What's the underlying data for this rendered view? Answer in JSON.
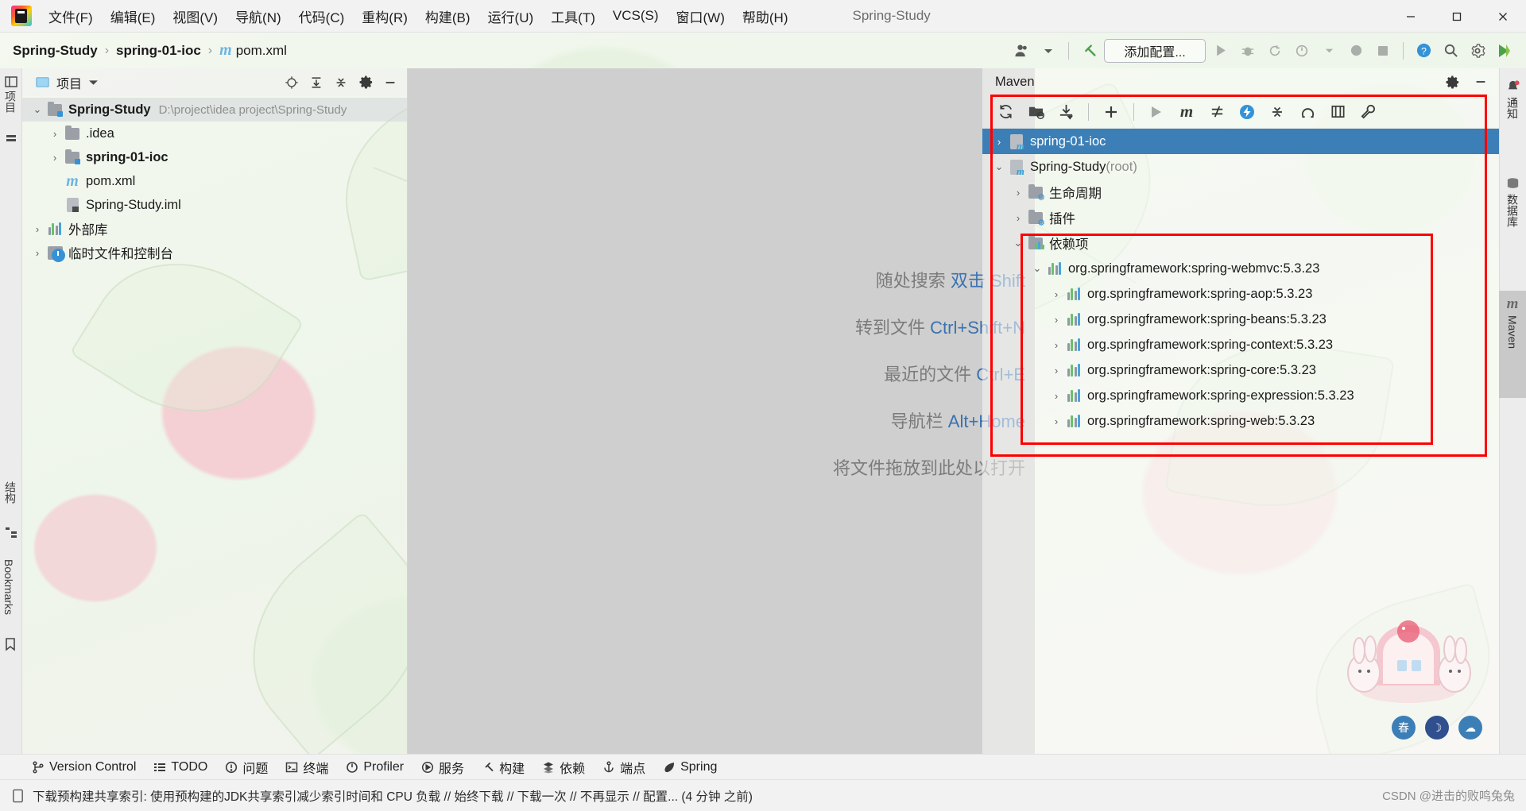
{
  "window": {
    "title": "Spring-Study",
    "minimize": "─",
    "maximize": "❐",
    "close": "✕"
  },
  "menubar": {
    "items": [
      {
        "label": "文件(F)"
      },
      {
        "label": "编辑(E)"
      },
      {
        "label": "视图(V)"
      },
      {
        "label": "导航(N)"
      },
      {
        "label": "代码(C)"
      },
      {
        "label": "重构(R)"
      },
      {
        "label": "构建(B)"
      },
      {
        "label": "运行(U)"
      },
      {
        "label": "工具(T)"
      },
      {
        "label": "VCS(S)"
      },
      {
        "label": "窗口(W)"
      },
      {
        "label": "帮助(H)"
      }
    ]
  },
  "navbar": {
    "breadcrumbs": [
      {
        "label": "Spring-Study",
        "bold": true
      },
      {
        "label": "spring-01-ioc",
        "bold": true
      },
      {
        "label": "pom.xml",
        "bold": false,
        "icon": "maven-file-icon"
      }
    ],
    "separator": "›",
    "run_config_label": "添加配置...",
    "icons": [
      {
        "name": "user-avatar-icon",
        "glyph": "👤"
      },
      {
        "name": "chevron-down-icon",
        "glyph": "▾"
      },
      {
        "name": "build-hammer-icon",
        "glyph": "⚒"
      },
      {
        "name": "run-icon",
        "glyph": "▶"
      },
      {
        "name": "debug-icon",
        "glyph": "🐞"
      },
      {
        "name": "run-with-coverage-icon",
        "glyph": "↻"
      },
      {
        "name": "profiler-icon",
        "glyph": "◴"
      },
      {
        "name": "more-dropdown-icon",
        "glyph": "▾"
      },
      {
        "name": "stop-record-icon",
        "glyph": "⬤"
      },
      {
        "name": "stop-icon",
        "glyph": "■"
      },
      {
        "name": "help-icon",
        "glyph": "?"
      },
      {
        "name": "search-everywhere-icon",
        "glyph": "🔍"
      },
      {
        "name": "settings-gear-icon",
        "glyph": "⚙"
      },
      {
        "name": "ide-assistant-icon",
        "glyph": "▶"
      }
    ]
  },
  "left_strip": {
    "items": [
      {
        "label": "项目",
        "name": "left-strip-project"
      },
      {
        "label": "结构",
        "name": "left-strip-structure"
      },
      {
        "label": "Bookmarks",
        "name": "left-strip-bookmarks"
      }
    ]
  },
  "right_strip": {
    "items": [
      {
        "label": "通知",
        "name": "right-strip-notifications",
        "icon": "bell-icon",
        "active": false
      },
      {
        "label": "数据库",
        "name": "right-strip-database",
        "icon": "database-icon",
        "active": false
      },
      {
        "label": "Maven",
        "name": "right-strip-maven",
        "icon": "maven-icon",
        "active": true
      }
    ]
  },
  "project_panel": {
    "title": "项目",
    "header_icons": [
      {
        "name": "select-opened-file-icon",
        "glyph": "⊕"
      },
      {
        "name": "expand-all-icon",
        "glyph": "↧"
      },
      {
        "name": "collapse-all-icon",
        "glyph": "↥"
      },
      {
        "name": "panel-settings-gear-icon",
        "glyph": "⚙"
      },
      {
        "name": "hide-panel-icon",
        "glyph": "─"
      }
    ],
    "tree": [
      {
        "label": "Spring-Study",
        "path": "D:\\project\\idea project\\Spring-Study",
        "indent": 0,
        "twist": "⌄",
        "icon": "module-folder-icon",
        "bold": true,
        "selected": true
      },
      {
        "label": ".idea",
        "path": "",
        "indent": 1,
        "twist": "›",
        "icon": "folder-icon",
        "bold": false,
        "selected": false
      },
      {
        "label": "spring-01-ioc",
        "path": "",
        "indent": 1,
        "twist": "›",
        "icon": "module-folder-icon",
        "bold": true,
        "selected": false
      },
      {
        "label": "pom.xml",
        "path": "",
        "indent": 1,
        "twist": "",
        "icon": "maven-file-icon",
        "bold": false,
        "selected": false
      },
      {
        "label": "Spring-Study.iml",
        "path": "",
        "indent": 1,
        "twist": "",
        "icon": "iml-file-icon",
        "bold": false,
        "selected": false
      },
      {
        "label": "外部库",
        "path": "",
        "indent": 0,
        "twist": "›",
        "icon": "library-icon",
        "bold": false,
        "selected": false
      },
      {
        "label": "临时文件和控制台",
        "path": "",
        "indent": 0,
        "twist": "›",
        "icon": "scratches-icon",
        "bold": false,
        "selected": false
      }
    ]
  },
  "editor": {
    "hints": [
      {
        "text": "随处搜索 ",
        "shortcut": "双击 Shift"
      },
      {
        "text": "转到文件 ",
        "shortcut": "Ctrl+Shift+N"
      },
      {
        "text": "最近的文件 ",
        "shortcut": "Ctrl+E"
      },
      {
        "text": "导航栏 ",
        "shortcut": "Alt+Home"
      }
    ],
    "drop_hint": "将文件拖放到此处以打开"
  },
  "maven_panel": {
    "title": "Maven",
    "header_icons": [
      {
        "name": "maven-settings-gear-icon",
        "glyph": "⚙"
      },
      {
        "name": "maven-hide-panel-icon",
        "glyph": "─"
      }
    ],
    "toolbar": [
      {
        "name": "reload-all-projects-icon",
        "glyph": "↻",
        "dim": false
      },
      {
        "name": "add-maven-project-icon",
        "glyph": "📁",
        "dim": false
      },
      {
        "name": "download-sources-icon",
        "glyph": "⤓",
        "dim": false
      },
      {
        "name": "toolbar-divider-1",
        "glyph": "|",
        "dim": false
      },
      {
        "name": "add-icon",
        "glyph": "＋",
        "dim": false
      },
      {
        "name": "toolbar-divider-2",
        "glyph": "|",
        "dim": false
      },
      {
        "name": "run-maven-build-icon",
        "glyph": "▶",
        "dim": true
      },
      {
        "name": "execute-maven-goal-icon",
        "glyph": "m",
        "dim": false
      },
      {
        "name": "toggle-skip-tests-icon",
        "glyph": "⫧",
        "dim": false
      },
      {
        "name": "toggle-offline-icon",
        "glyph": "⚡",
        "dim": false
      },
      {
        "name": "collapse-all-maven-icon",
        "glyph": "↥",
        "dim": false
      },
      {
        "name": "show-dependencies-icon",
        "glyph": "Ω",
        "dim": false
      },
      {
        "name": "expand-dependencies-icon",
        "glyph": "⧉",
        "dim": false
      },
      {
        "name": "maven-settings-icon",
        "glyph": "🔧",
        "dim": false
      }
    ],
    "tree": [
      {
        "label": "spring-01-ioc",
        "suffix": "",
        "indent": 0,
        "twist": "›",
        "icon": "maven-module-icon",
        "selected": true
      },
      {
        "label": "Spring-Study",
        "suffix": " (root)",
        "indent": 0,
        "twist": "⌄",
        "icon": "maven-module-icon",
        "selected": false
      },
      {
        "label": "生命周期",
        "suffix": "",
        "indent": 1,
        "twist": "›",
        "icon": "lifecycle-folder-icon",
        "selected": false
      },
      {
        "label": "插件",
        "suffix": "",
        "indent": 1,
        "twist": "›",
        "icon": "plugins-folder-icon",
        "selected": false
      },
      {
        "label": "依赖项",
        "suffix": "",
        "indent": 1,
        "twist": "⌄",
        "icon": "dependencies-folder-icon",
        "selected": false
      },
      {
        "label": "org.springframework:spring-webmvc:5.3.23",
        "suffix": "",
        "indent": 2,
        "twist": "⌄",
        "icon": "dependency-icon",
        "selected": false
      },
      {
        "label": "org.springframework:spring-aop:5.3.23",
        "suffix": "",
        "indent": 3,
        "twist": "›",
        "icon": "dependency-icon",
        "selected": false
      },
      {
        "label": "org.springframework:spring-beans:5.3.23",
        "suffix": "",
        "indent": 3,
        "twist": "›",
        "icon": "dependency-icon",
        "selected": false
      },
      {
        "label": "org.springframework:spring-context:5.3.23",
        "suffix": "",
        "indent": 3,
        "twist": "›",
        "icon": "dependency-icon",
        "selected": false
      },
      {
        "label": "org.springframework:spring-core:5.3.23",
        "suffix": "",
        "indent": 3,
        "twist": "›",
        "icon": "dependency-icon",
        "selected": false
      },
      {
        "label": "org.springframework:spring-expression:5.3.23",
        "suffix": "",
        "indent": 3,
        "twist": "›",
        "icon": "dependency-icon",
        "selected": false
      },
      {
        "label": "org.springframework:spring-web:5.3.23",
        "suffix": "",
        "indent": 3,
        "twist": "›",
        "icon": "dependency-icon",
        "selected": false
      }
    ]
  },
  "bottom_bar": {
    "items": [
      {
        "label": "Version Control",
        "icon": "branch-icon",
        "glyph": "⑂"
      },
      {
        "label": "TODO",
        "icon": "todo-list-icon",
        "glyph": "☰"
      },
      {
        "label": "问题",
        "icon": "problems-icon",
        "glyph": "⊘"
      },
      {
        "label": "终端",
        "icon": "terminal-icon",
        "glyph": "⌨"
      },
      {
        "label": "Profiler",
        "icon": "profiler-icon",
        "glyph": "◴"
      },
      {
        "label": "服务",
        "icon": "services-icon",
        "glyph": "▷"
      },
      {
        "label": "构建",
        "icon": "build-hammer-icon",
        "glyph": "⚒"
      },
      {
        "label": "依赖",
        "icon": "dependencies-icon",
        "glyph": "≣"
      },
      {
        "label": "端点",
        "icon": "endpoints-icon",
        "glyph": "⚓"
      },
      {
        "label": "Spring",
        "icon": "spring-leaf-icon",
        "glyph": "❦"
      }
    ]
  },
  "status_bar": {
    "icon": "notification-doc-icon",
    "message": "下载预构建共享索引: 使用预构建的JDK共享索引减少索引时间和 CPU 负载 // 始终下载 // 下载一次 // 不再显示 // 配置... (4 分钟 之前)",
    "watermark": "CSDN @进击的败鸣兔兔"
  },
  "colors": {
    "accent_blue": "#3c7fb7",
    "annotation_red": "#ff0000",
    "link_blue": "#3b72b0",
    "editor_bg": "#cfcfcf"
  }
}
